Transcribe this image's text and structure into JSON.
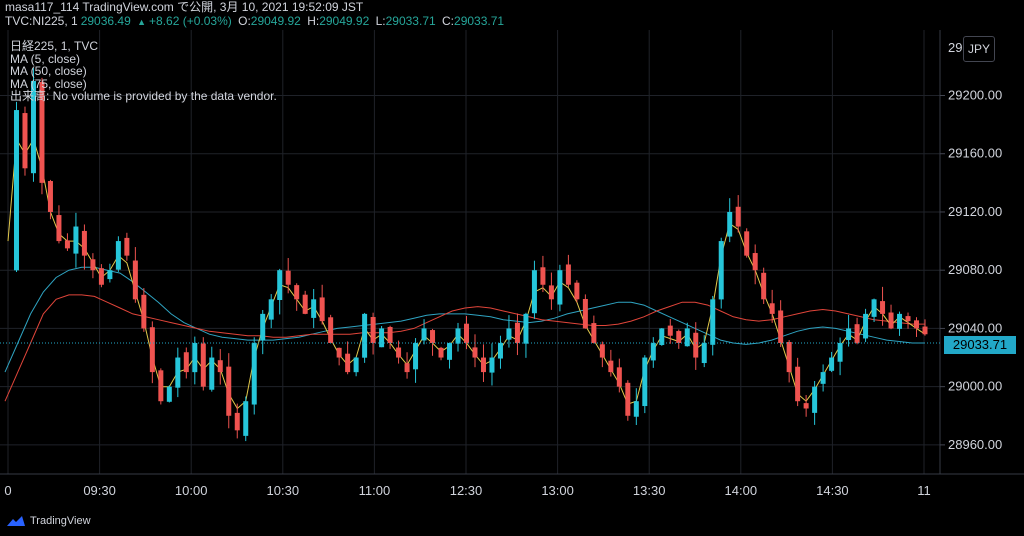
{
  "header": {
    "line1": "masa117_114 TradingView.com で公開, 3月 10, 2021 19:52:09 JST",
    "symbol": "TVC:NI225, 1",
    "last": "29036.49",
    "change": "+8.62 (+0.03%)",
    "o_label": "O:",
    "o_val": "29049.92",
    "h_label": "H:",
    "h_val": "29049.92",
    "l_label": "L:",
    "l_val": "29033.71",
    "c_label": "C:",
    "c_val": "29033.71"
  },
  "legend": {
    "title": "日経225, 1, TVC",
    "ma5": "MA (5, close)",
    "ma50": "MA (50, close)",
    "ma75": "MA (75, close)",
    "volume": "出来高: No volume is provided by the data vendor."
  },
  "currency": "JPY",
  "price_badge": "29033.71",
  "brand": "TradingView",
  "colors": {
    "up": "#26a69a",
    "up_candle": "#26c6da",
    "down": "#ef5350",
    "ma5": "#e2c94b",
    "ma50": "#e0453a",
    "ma75": "#2fa4c2",
    "grid": "#1f2229",
    "badge": "#22a8c8"
  },
  "chart_data": {
    "type": "candlestick",
    "y_ticks": [
      "29200.00",
      "29160.00",
      "29120.00",
      "29080.00",
      "29040.00",
      "29000.00",
      "28960.00"
    ],
    "y_tick_values": [
      29200,
      29160,
      29120,
      29080,
      29040,
      29000,
      28960
    ],
    "ylim": [
      28940,
      29245
    ],
    "y_top_partial": "29 2",
    "x_ticks": [
      "0",
      "09:30",
      "10:00",
      "10:30",
      "11:00",
      "12:30",
      "13:00",
      "13:30",
      "14:00",
      "14:30",
      "11"
    ],
    "close_path": [
      29080,
      29190,
      29150,
      29210,
      29140,
      29120,
      29100,
      29095,
      29110,
      29090,
      29080,
      29070,
      29080,
      29100,
      29090,
      29060,
      29040,
      29010,
      28990,
      29000,
      29020,
      29010,
      29030,
      29000,
      29020,
      29010,
      28980,
      28970,
      28990,
      29030,
      29050,
      29060,
      29080,
      29070,
      29060,
      29050,
      29060,
      29045,
      29030,
      29020,
      29010,
      29020,
      29050,
      29030,
      29040,
      29030,
      29020,
      29010,
      29030,
      29040,
      29030,
      29020,
      29030,
      29040,
      29030,
      29020,
      29010,
      29020,
      29030,
      29040,
      29030,
      29050,
      29080,
      29070,
      29060,
      29080,
      29070,
      29060,
      29040,
      29030,
      29020,
      29010,
      29000,
      28980,
      28990,
      29020,
      29030,
      29040,
      29035,
      29030,
      29040,
      29020,
      29030,
      29060,
      29100,
      29120,
      29110,
      29090,
      29080,
      29060,
      29050,
      29030,
      29010,
      28990,
      28985,
      29000,
      29010,
      29020,
      29030,
      29040,
      29030,
      29050,
      29060,
      29050,
      29040,
      29050,
      29045,
      29040,
      29036
    ],
    "ma5_path": [
      29100,
      29170,
      29160,
      29170,
      29150,
      29120,
      29105,
      29100,
      29100,
      29095,
      29085,
      29075,
      29080,
      29090,
      29085,
      29065,
      29045,
      29020,
      29000,
      29000,
      29010,
      29012,
      29020,
      29012,
      29018,
      29012,
      28995,
      28985,
      28990,
      29020,
      29040,
      29055,
      29070,
      29068,
      29060,
      29052,
      29055,
      29045,
      29033,
      29022,
      29015,
      29020,
      29040,
      29032,
      29036,
      29030,
      29022,
      29015,
      29025,
      29035,
      29030,
      29024,
      29028,
      29036,
      29030,
      29022,
      29015,
      29018,
      29026,
      29035,
      29032,
      29045,
      29065,
      29068,
      29062,
      29072,
      29068,
      29058,
      29042,
      29032,
      29022,
      29012,
      29002,
      28988,
      28990,
      29012,
      29025,
      29035,
      29033,
      29031,
      29036,
      29026,
      29030,
      29055,
      29090,
      29112,
      29108,
      29092,
      29080,
      29064,
      29050,
      29032,
      29014,
      28995,
      28990,
      28998,
      29008,
      29018,
      29028,
      29036,
      29032,
      29045,
      29055,
      29050,
      29042,
      29048,
      29044,
      29040,
      29036
    ],
    "ma50_path": [
      28990,
      29010,
      29030,
      29050,
      29060,
      29063,
      29063,
      29062,
      29058,
      29054,
      29050,
      29048,
      29046,
      29044,
      29042,
      29040,
      29038,
      29037,
      29036,
      29035,
      29035,
      29034,
      29034,
      29035,
      29036,
      29036,
      29036,
      29036,
      29037,
      29037,
      29037,
      29038,
      29040,
      29044,
      29048,
      29052,
      29054,
      29055,
      29054,
      29052,
      29050,
      29048,
      29046,
      29045,
      29044,
      29043,
      29042,
      29042,
      29043,
      29045,
      29048,
      29052,
      29055,
      29058,
      29058,
      29056,
      29052,
      29048,
      29046,
      29045,
      29046,
      29048,
      29050,
      29052,
      29053,
      29052,
      29050,
      29048,
      29046,
      29045,
      29044,
      29043,
      29043
    ],
    "ma75_path": [
      29010,
      29030,
      29050,
      29065,
      29075,
      29080,
      29082,
      29082,
      29080,
      29078,
      29072,
      29065,
      29058,
      29050,
      29044,
      29040,
      29036,
      29034,
      29033,
      29032,
      29032,
      29032,
      29033,
      29034,
      29036,
      29038,
      29040,
      29041,
      29042,
      29043,
      29044,
      29045,
      29047,
      29049,
      29050,
      29050,
      29050,
      29049,
      29048,
      29046,
      29045,
      29044,
      29045,
      29047,
      29050,
      29052,
      29054,
      29056,
      29058,
      29058,
      29056,
      29052,
      29048,
      29044,
      29040,
      29036,
      29032,
      29030,
      29029,
      29030,
      29032,
      29035,
      29038,
      29040,
      29041,
      29040,
      29038,
      29036,
      29034,
      29032,
      29031,
      29030,
      29030
    ]
  }
}
